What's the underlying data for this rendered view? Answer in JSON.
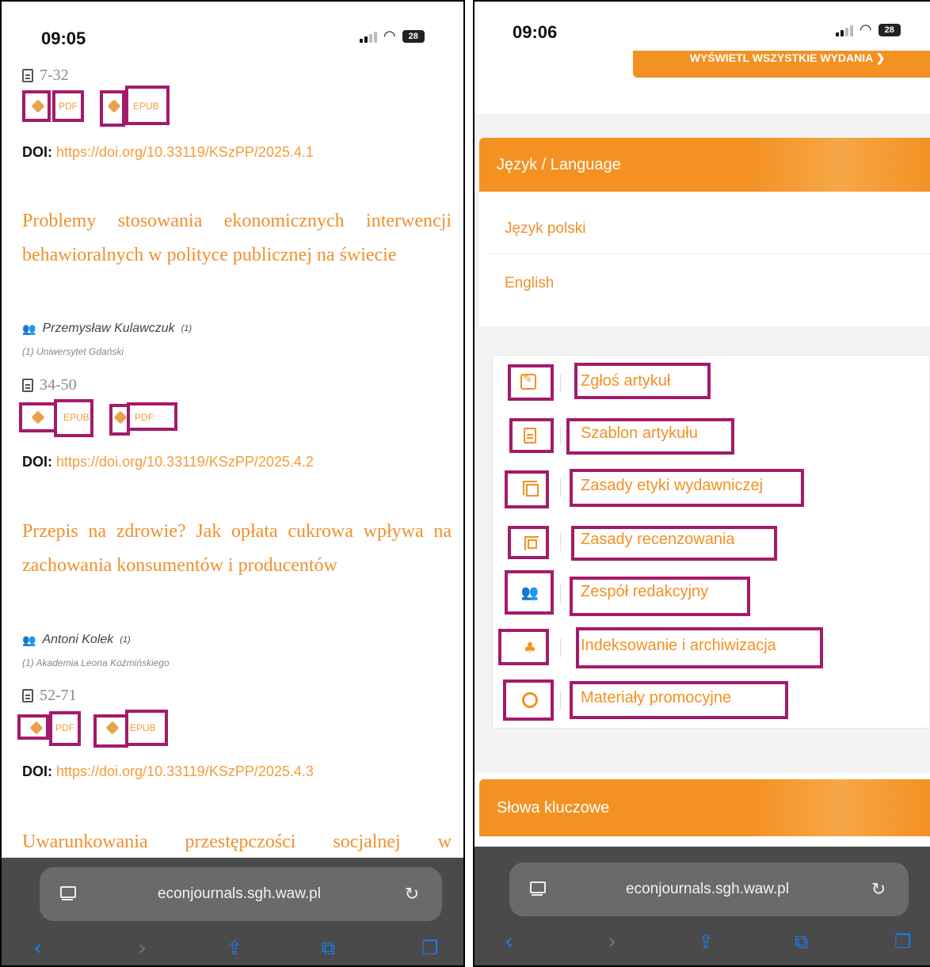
{
  "left_phone": {
    "time": "09:05",
    "battery": "28",
    "articles": [
      {
        "pages": "7-32",
        "buttons": [
          "PDF",
          "EPUB"
        ],
        "doi_label": "DOI:",
        "doi_link": "https://doi.org/10.33119/KSzPP/2025.4.1"
      },
      {
        "title": "Problemy stosowania ekonomicznych interwencji behawioralnych w polityce publicznej na świecie",
        "author": "Przemysław Kulawczuk",
        "author_ref": "(1)",
        "affiliation": "(1) Uniwersytet Gdański",
        "pages": "34-50",
        "buttons": [
          "EPUB",
          "PDF"
        ],
        "doi_label": "DOI:",
        "doi_link": "https://doi.org/10.33119/KSzPP/2025.4.2"
      },
      {
        "title": "Przepis na zdrowie? Jak opłata cukrowa wpływa na zachowania konsumentów i producentów",
        "author": "Antoni Kolek",
        "author_ref": "(1)",
        "affiliation": "(1) Akademia Leona Koźmińskiego",
        "pages": "52-71",
        "buttons": [
          "PDF",
          "EPUB"
        ],
        "doi_label": "DOI:",
        "doi_link": "https://doi.org/10.33119/KSzPP/2025.4.3"
      },
      {
        "title": "Uwarunkowania przestępczości socjalnej w"
      }
    ],
    "browser": {
      "url": "econjournals.sgh.waw.pl"
    }
  },
  "right_phone": {
    "time": "09:06",
    "battery": "28",
    "top_button": "WYŚWIETL WSZYSTKIE WYDANIA ❯",
    "language_panel": {
      "title": "Język / Language",
      "items": [
        "Język polski",
        "English"
      ]
    },
    "menu": [
      {
        "icon": "edit-icon",
        "label": "Zgłoś artykuł"
      },
      {
        "icon": "document-icon",
        "label": "Szablon artykułu"
      },
      {
        "icon": "copy-icon",
        "label": "Zasady etyki wydawniczej"
      },
      {
        "icon": "clone-icon",
        "label": "Zasady recenzowania"
      },
      {
        "icon": "users-icon",
        "label": "Zespół redakcyjny"
      },
      {
        "icon": "sitemap-icon",
        "label": "Indeksowanie i archiwizacja"
      },
      {
        "icon": "circle-icon",
        "label": "Materiały promocyjne"
      }
    ],
    "keywords_panel": {
      "title": "Słowa kluczowe"
    },
    "browser": {
      "url": "econjournals.sgh.waw.pl"
    }
  },
  "colors": {
    "accent": "#f39122",
    "highlight": "#a51a6b",
    "link": "#f0902d",
    "browser_bar": "#4a4a4a",
    "nav_active": "#1e7cf2"
  }
}
